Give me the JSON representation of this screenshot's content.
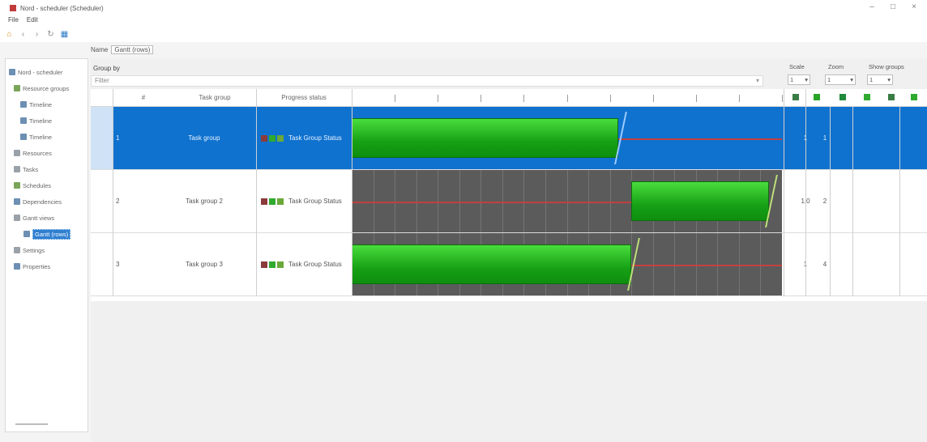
{
  "window": {
    "title": "Nord - scheduler (Scheduler)",
    "controls": [
      "–",
      "□",
      "×"
    ]
  },
  "menu": [
    "File",
    "Edit"
  ],
  "toolbar": {
    "icons": [
      "home-icon",
      "back-icon",
      "forward-icon",
      "refresh-icon",
      "grid-icon"
    ]
  },
  "path": {
    "label": "Name",
    "value": "Gantt (rows)"
  },
  "tree": {
    "items": [
      {
        "label": "Nord - scheduler",
        "icon": "project-icon"
      },
      {
        "label": "Resource groups",
        "icon": "folder-icon"
      },
      {
        "label": "Timeline",
        "icon": "timeline-icon"
      },
      {
        "label": "Timeline",
        "icon": "timeline-icon"
      },
      {
        "label": "Timeline",
        "icon": "timeline-icon"
      },
      {
        "label": "Resources",
        "icon": "resource-icon"
      },
      {
        "label": "Tasks",
        "icon": "task-icon"
      },
      {
        "label": "Schedules",
        "icon": "schedule-icon"
      },
      {
        "label": "Dependencies",
        "icon": "dependency-icon"
      },
      {
        "label": "Gantt views",
        "icon": "gantt-icon"
      },
      {
        "label": "Gantt (rows)",
        "icon": "gantt-icon",
        "selected": true
      },
      {
        "label": "Settings",
        "icon": "settings-icon"
      },
      {
        "label": "Properties",
        "icon": "properties-icon"
      }
    ]
  },
  "main": {
    "group_label": "Group by",
    "filter_placeholder": "Filter",
    "controls": [
      {
        "label": "Scale",
        "value": "1"
      },
      {
        "label": "Zoom",
        "value": "1"
      },
      {
        "label": "Show groups",
        "value": "1"
      }
    ]
  },
  "grid": {
    "headers": [
      "#",
      "Task group",
      "Progress status"
    ],
    "rows": [
      {
        "index": "1",
        "name": "Task group",
        "status": "Task Group Status",
        "selected": true,
        "bar_start": 0.0,
        "bar_end": 0.62,
        "line_end": 1.0,
        "val_a": "1",
        "val_b": "1"
      },
      {
        "index": "2",
        "name": "Task group 2",
        "status": "Task Group Status",
        "selected": false,
        "bar_start": 0.65,
        "bar_end": 0.97,
        "line_end": 0.65,
        "val_a": "1.0",
        "val_b": "2"
      },
      {
        "index": "3",
        "name": "Task group 3",
        "status": "Task Group Status",
        "selected": false,
        "bar_start": 0.0,
        "bar_end": 0.65,
        "line_end": 1.0,
        "val_a": "1",
        "val_b": "4"
      }
    ]
  },
  "colors": {
    "accent": "#0f72cf",
    "bar_green": "#17a016",
    "dark_track": "#5b5b5b",
    "line_red": "#c44040"
  }
}
